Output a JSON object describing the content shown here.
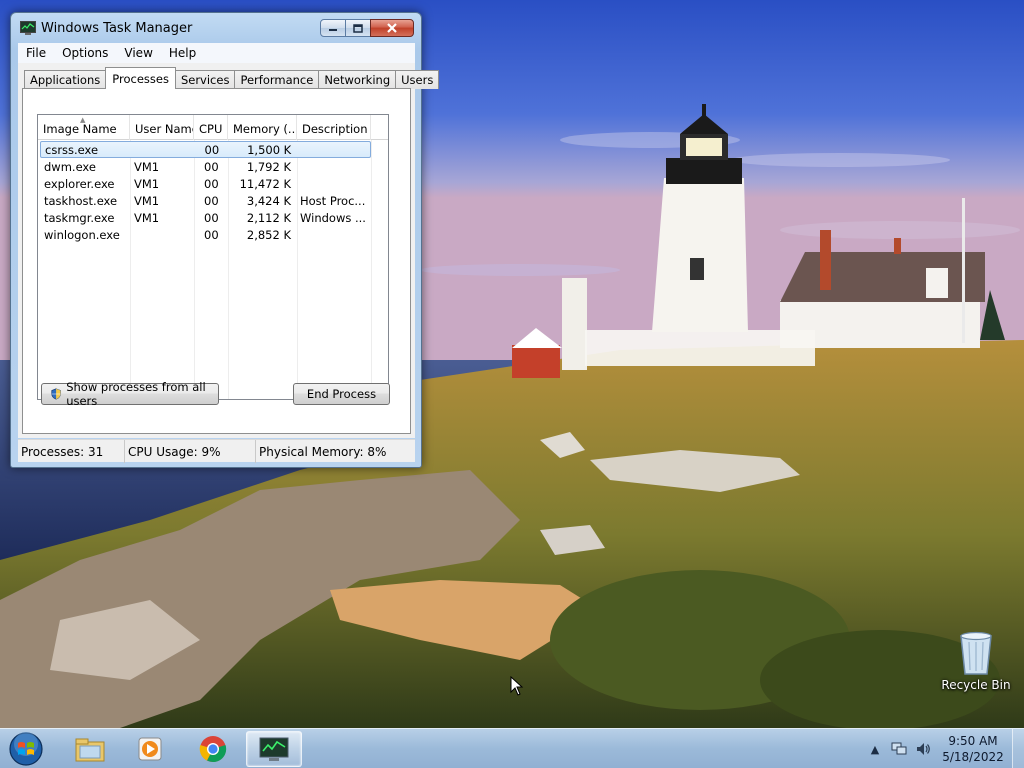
{
  "window": {
    "title": "Windows Task Manager",
    "menu": [
      "File",
      "Options",
      "View",
      "Help"
    ],
    "tabs": [
      "Applications",
      "Processes",
      "Services",
      "Performance",
      "Networking",
      "Users"
    ],
    "active_tab": "Processes",
    "columns": [
      "Image Name",
      "User Name",
      "CPU",
      "Memory (...",
      "Description"
    ],
    "rows": [
      {
        "image": "csrss.exe",
        "user": "",
        "cpu": "00",
        "mem": "1,500 K",
        "desc": ""
      },
      {
        "image": "dwm.exe",
        "user": "VM1",
        "cpu": "00",
        "mem": "1,792 K",
        "desc": ""
      },
      {
        "image": "explorer.exe",
        "user": "VM1",
        "cpu": "00",
        "mem": "11,472 K",
        "desc": ""
      },
      {
        "image": "taskhost.exe",
        "user": "VM1",
        "cpu": "00",
        "mem": "3,424 K",
        "desc": "Host Proc..."
      },
      {
        "image": "taskmgr.exe",
        "user": "VM1",
        "cpu": "00",
        "mem": "2,112 K",
        "desc": "Windows ..."
      },
      {
        "image": "winlogon.exe",
        "user": "",
        "cpu": "00",
        "mem": "2,852 K",
        "desc": ""
      }
    ],
    "show_all_label": "Show processes from all users",
    "end_process_label": "End Process",
    "status": {
      "processes": "Processes: 31",
      "cpu": "CPU Usage: 9%",
      "memory": "Physical Memory: 8%"
    }
  },
  "desktop": {
    "recycle_bin_label": "Recycle Bin"
  },
  "taskbar": {
    "apps": [
      "file-explorer-icon",
      "media-player-icon",
      "chrome-icon",
      "task-manager-icon"
    ],
    "clock_time": "9:50 AM",
    "clock_date": "5/18/2022"
  },
  "colors": {
    "selection": "#d8ebfb",
    "close_button": "#c04029",
    "taskbar": "#96b6d7"
  }
}
